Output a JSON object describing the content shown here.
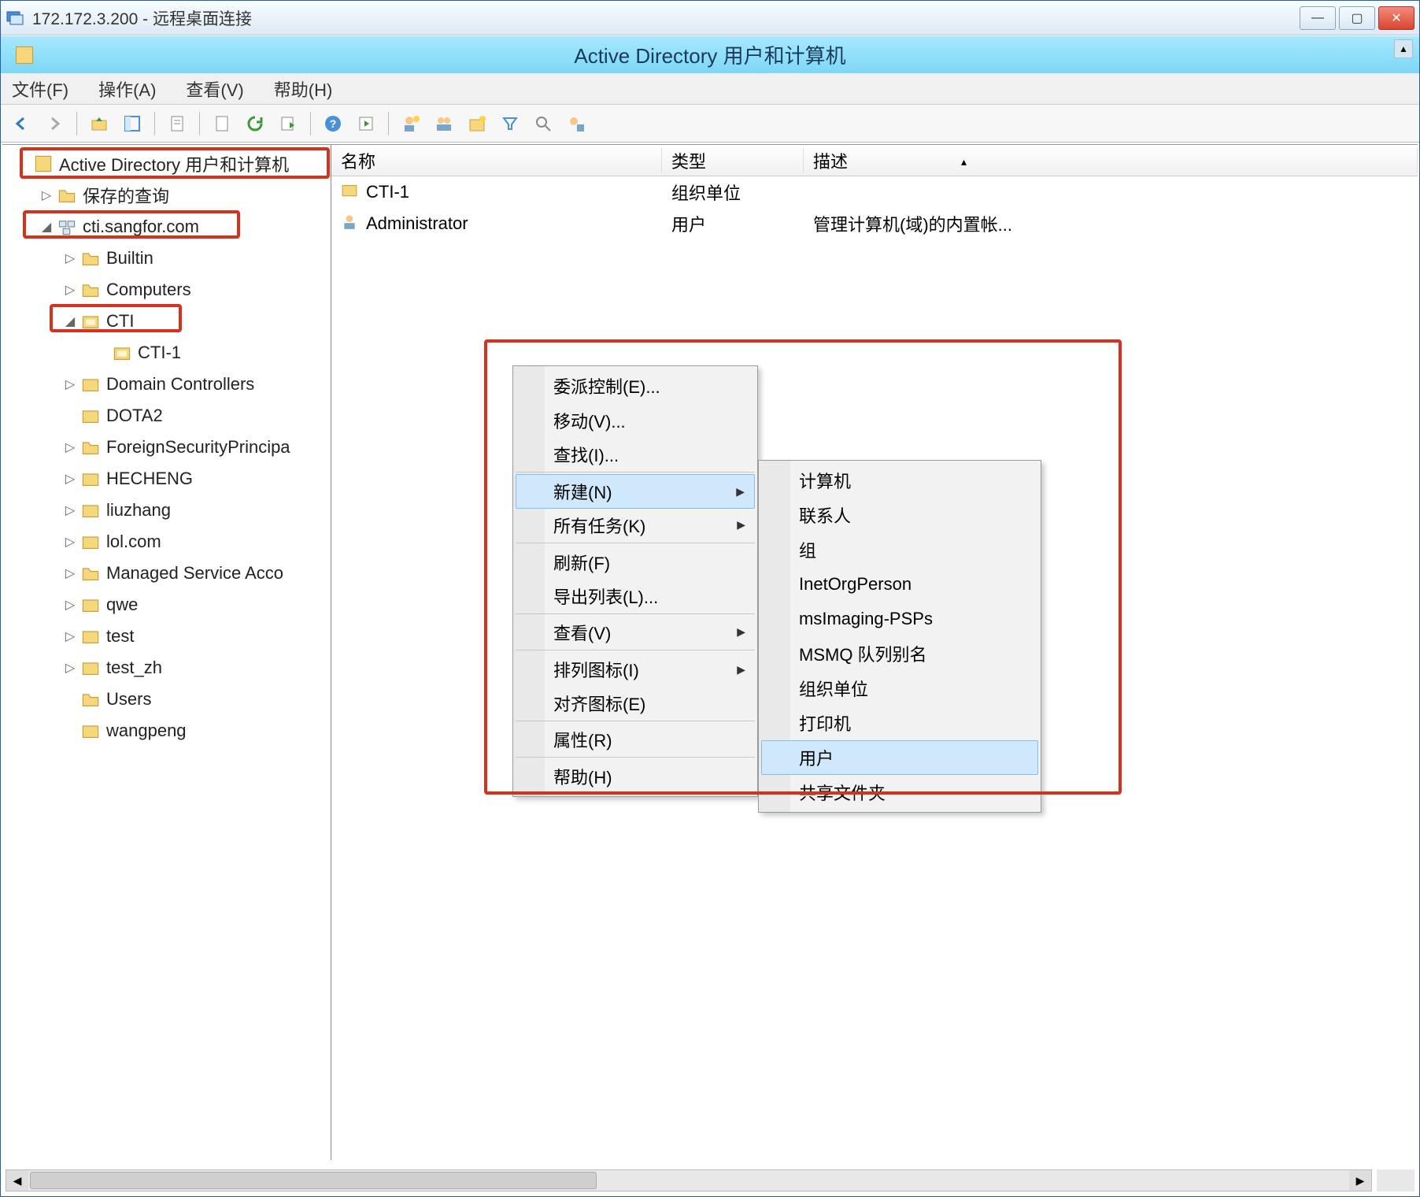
{
  "rdp": {
    "title": "172.172.3.200 - 远程桌面连接"
  },
  "ad_window": {
    "title": "Active Directory 用户和计算机"
  },
  "menubar": {
    "file": "文件(F)",
    "action": "操作(A)",
    "view": "查看(V)",
    "help": "帮助(H)"
  },
  "tree": {
    "root": "Active Directory 用户和计算机",
    "saved_queries": "保存的查询",
    "domain": "cti.sangfor.com",
    "n_builtin": "Builtin",
    "n_computers": "Computers",
    "n_cti": "CTI",
    "n_cti1": "CTI-1",
    "n_dc": "Domain Controllers",
    "n_dota2": "DOTA2",
    "n_fsp": "ForeignSecurityPrincipa",
    "n_hecheng": "HECHENG",
    "n_liuzhang": "liuzhang",
    "n_lol": "lol.com",
    "n_msa": "Managed Service Acco",
    "n_qwe": "qwe",
    "n_test": "test",
    "n_testzh": "test_zh",
    "n_users": "Users",
    "n_wangpeng": "wangpeng"
  },
  "list": {
    "col_name": "名称",
    "col_type": "类型",
    "col_desc": "描述",
    "rows": [
      {
        "name": "CTI-1",
        "type": "组织单位",
        "desc": ""
      },
      {
        "name": "Administrator",
        "type": "用户",
        "desc": "管理计算机(域)的内置帐..."
      }
    ]
  },
  "ctx_main": {
    "delegate": "委派控制(E)...",
    "move": "移动(V)...",
    "find": "查找(I)...",
    "new": "新建(N)",
    "alltasks": "所有任务(K)",
    "refresh": "刷新(F)",
    "exportlist": "导出列表(L)...",
    "view": "查看(V)",
    "arrange": "排列图标(I)",
    "align": "对齐图标(E)",
    "properties": "属性(R)",
    "help": "帮助(H)"
  },
  "ctx_sub": {
    "computer": "计算机",
    "contact": "联系人",
    "group": "组",
    "inetorg": "InetOrgPerson",
    "msimg": "msImaging-PSPs",
    "msmq": "MSMQ 队列别名",
    "ou": "组织单位",
    "printer": "打印机",
    "user": "用户",
    "shared": "共享文件夹"
  }
}
